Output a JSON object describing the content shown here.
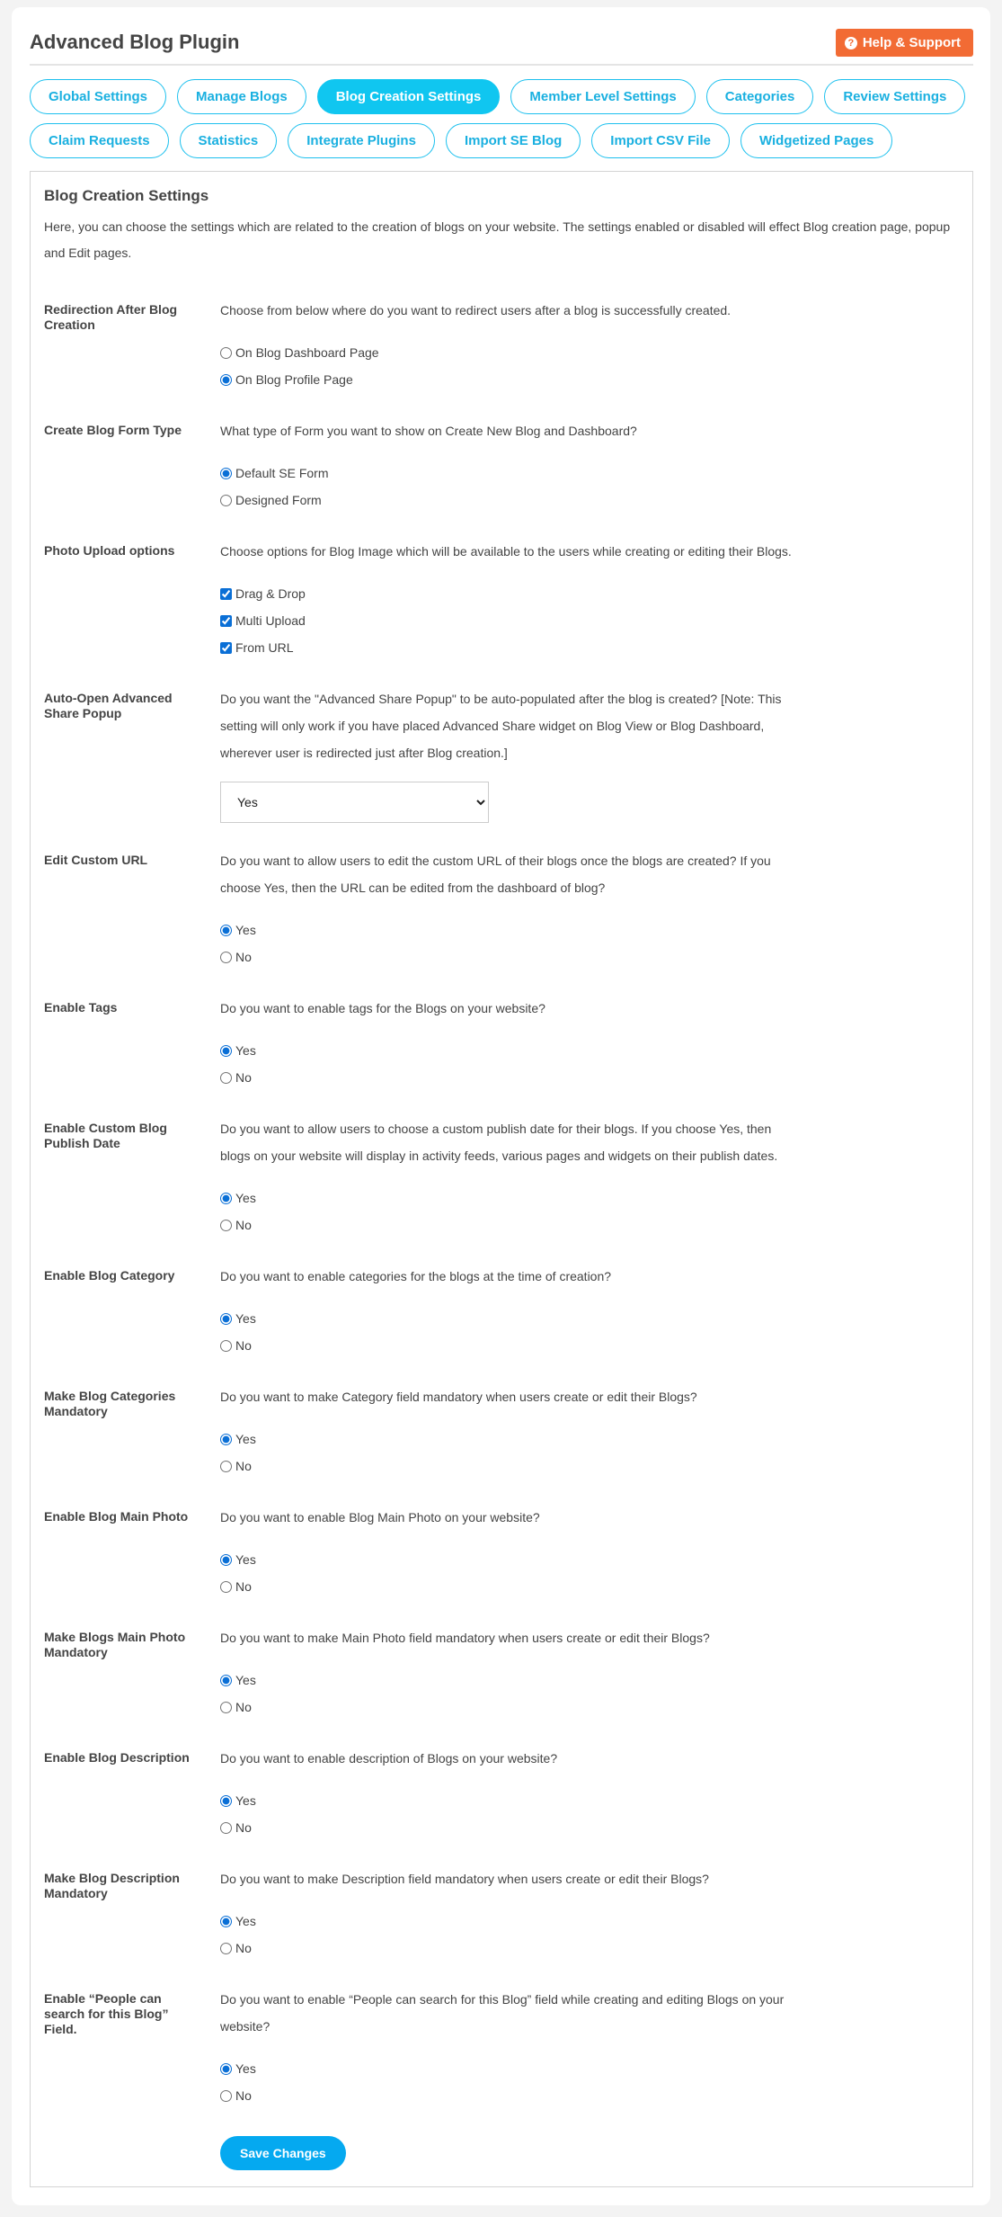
{
  "header": {
    "title": "Advanced Blog Plugin",
    "help_label": "Help & Support",
    "help_icon": "question-circle-icon"
  },
  "tabs_row1": [
    "Global Settings",
    "Manage Blogs",
    "Blog Creation Settings",
    "Member Level Settings",
    "Categories",
    "Review Settings"
  ],
  "tabs_row2": [
    "Claim Requests",
    "Statistics",
    "Integrate Plugins",
    "Import SE Blog",
    "Import CSV File",
    "Widgetized Pages"
  ],
  "active_tab": "Blog Creation Settings",
  "colors": {
    "accent": "#10c6f0",
    "help": "#f26b34",
    "save": "#05a9f0"
  },
  "section": {
    "title": "Blog Creation Settings",
    "intro": "Here, you can choose the settings which are related to the creation of blogs on your website. The settings enabled or disabled will effect Blog creation page, popup and Edit pages."
  },
  "settings": [
    {
      "label": "Redirection After Blog Creation",
      "desc": "Choose from below where do you want to redirect users after a blog is successfully created.",
      "type": "radio",
      "options": [
        "On Blog Dashboard Page",
        "On Blog Profile Page"
      ],
      "selected": 1
    },
    {
      "label": "Create Blog Form Type",
      "desc": "What type of Form you want to show on Create New Blog and Dashboard?",
      "type": "radio",
      "options": [
        "Default SE Form",
        "Designed Form"
      ],
      "selected": 0
    },
    {
      "label": "Photo Upload options",
      "desc": "Choose options for Blog Image which will be available to the users while creating or editing their Blogs.",
      "type": "checkbox",
      "options": [
        "Drag & Drop",
        "Multi Upload",
        "From URL"
      ],
      "checked": [
        true,
        true,
        true
      ]
    },
    {
      "label": "Auto-Open Advanced Share Popup",
      "desc": "Do you want the \"Advanced Share Popup\" to be auto-populated after the blog is created? [Note: This setting will only work if you have placed Advanced Share widget on Blog View or Blog Dashboard, wherever user is redirected just after Blog creation.]",
      "type": "select",
      "value": "Yes"
    },
    {
      "label": "Edit Custom URL",
      "desc": "Do you want to allow users to edit the custom URL of their blogs once the blogs are created? If you choose Yes, then the URL can be edited from the dashboard of blog?",
      "type": "radio",
      "options": [
        "Yes",
        "No"
      ],
      "selected": 0
    },
    {
      "label": "Enable Tags",
      "desc": "Do you want to enable tags for the Blogs on your website?",
      "type": "radio",
      "options": [
        "Yes",
        "No"
      ],
      "selected": 0
    },
    {
      "label": "Enable Custom Blog Publish Date",
      "desc": "Do you want to allow users to choose a custom publish date for their blogs. If you choose Yes, then blogs on your website will display in activity feeds, various pages and widgets on their publish dates.",
      "type": "radio",
      "options": [
        "Yes",
        "No"
      ],
      "selected": 0
    },
    {
      "label": "Enable Blog Category",
      "desc": "Do you want to enable categories for the blogs at the time of creation?",
      "type": "radio",
      "options": [
        "Yes",
        "No"
      ],
      "selected": 0
    },
    {
      "label": "Make Blog Categories Mandatory",
      "desc": "Do you want to make Category field mandatory when users create or edit their Blogs?",
      "type": "radio",
      "options": [
        "Yes",
        "No"
      ],
      "selected": 0
    },
    {
      "label": "Enable Blog Main Photo",
      "desc": "Do you want to enable Blog Main Photo on your website?",
      "type": "radio",
      "options": [
        "Yes",
        "No"
      ],
      "selected": 0
    },
    {
      "label": "Make Blogs Main Photo Mandatory",
      "desc": "Do you want to make Main Photo field mandatory when users create or edit their Blogs?",
      "type": "radio",
      "options": [
        "Yes",
        "No"
      ],
      "selected": 0
    },
    {
      "label": "Enable Blog Description",
      "desc": "Do you want to enable description of Blogs on your website?",
      "type": "radio",
      "options": [
        "Yes",
        "No"
      ],
      "selected": 0
    },
    {
      "label": "Make Blog Description Mandatory",
      "desc": "Do you want to make Description field mandatory when users create or edit their Blogs?",
      "type": "radio",
      "options": [
        "Yes",
        "No"
      ],
      "selected": 0
    },
    {
      "label": "Enable “People can search for this Blog” Field.",
      "desc": "Do you want to enable “People can search for this Blog” field while creating and editing Blogs on your website?",
      "type": "radio",
      "options": [
        "Yes",
        "No"
      ],
      "selected": 0
    }
  ],
  "save_label": "Save Changes"
}
